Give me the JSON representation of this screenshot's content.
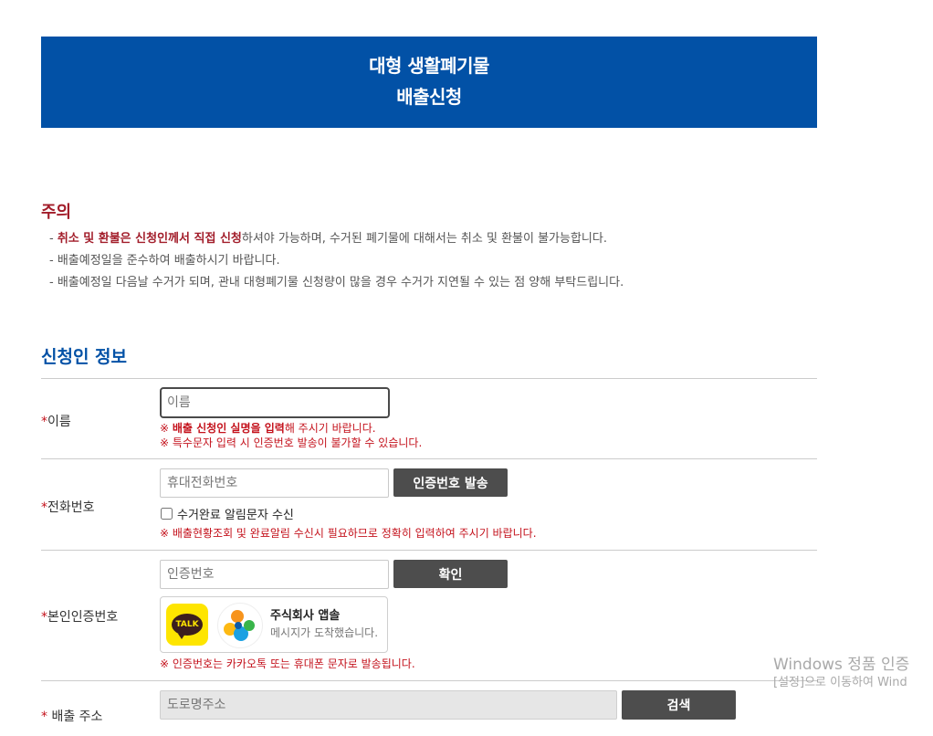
{
  "banner": {
    "line1": "대형 생활폐기물",
    "line2": "배출신청"
  },
  "notice": {
    "title": "주의",
    "items": [
      {
        "prefix": "- ",
        "emph": "취소 및 환불은 신청인께서 직접 신청",
        "rest": "하셔야 가능하며, 수거된 폐기물에 대해서는 취소 및 환불이 불가능합니다."
      },
      {
        "prefix": "- ",
        "emph": "",
        "rest": "배출예정일을 준수하여 배출하시기 바랍니다."
      },
      {
        "prefix": "- ",
        "emph": "",
        "rest": "배출예정일 다음날 수거가 되며, 관내 대형폐기물 신청량이 많을 경우 수거가 지연될 수 있는 점 양해 부탁드립니다."
      }
    ]
  },
  "applicant": {
    "section_title": "신청인 정보",
    "name": {
      "required_mark": "*",
      "label": "이름",
      "placeholder": "이름",
      "note1_mark": "※ ",
      "note1_bold": "배출 신청인 실명을 입력",
      "note1_rest": "해 주시기 바랍니다.",
      "note2": "※ 특수문자 입력 시 인증번호 발송이 불가할 수 있습니다."
    },
    "phone": {
      "required_mark": "*",
      "label": "전화번호",
      "placeholder": "휴대전화번호",
      "send_button": "인증번호 발송",
      "checkbox_label": "수거완료 알림문자 수신",
      "note": "※ 배출현황조회 및 완료알림 수신시 필요하므로 정확히 입력하여 주시기 바랍니다."
    },
    "verify": {
      "required_mark": "*",
      "label": "본인인증번호",
      "placeholder": "인증번호",
      "confirm_button": "확인",
      "card_icon_text": "TALK",
      "card_title": "주식회사 앱솔",
      "card_sub": "메시지가 도착했습니다.",
      "note": "※ 인증번호는 카카오톡 또는 휴대폰 문자로 발송됩니다."
    },
    "address": {
      "required_mark": "*",
      "label": " 배출 주소",
      "placeholder": "도로명주소",
      "search_button": "검색"
    }
  },
  "watermark": {
    "line1": "Windows 정품 인증",
    "line2": "[설정]으로 이동하여 Wind"
  },
  "colors": {
    "brand_blue": "#0251a6",
    "alert_red": "#c4121c",
    "button_dark": "#4d4d4d",
    "kakao_yellow": "#fee500"
  }
}
